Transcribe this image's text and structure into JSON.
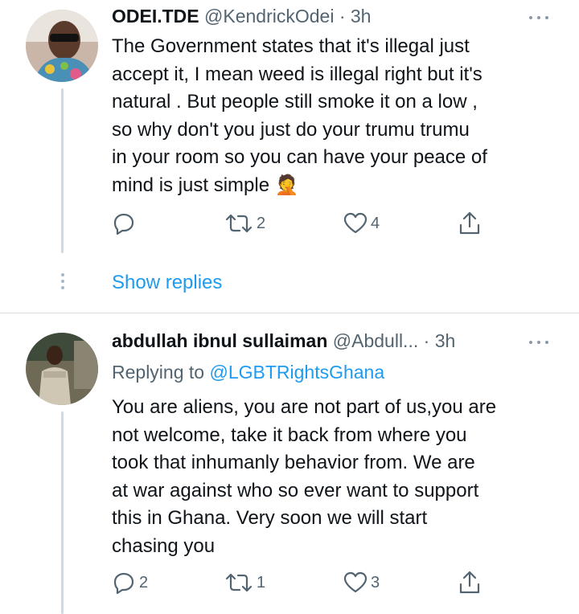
{
  "tweets": [
    {
      "name": "ODEI.TDE",
      "handle": "@KendrickOdei",
      "separator": "·",
      "time": "3h",
      "text_lines": [
        "The Government states that it's illegal just",
        "accept it, I mean weed is illegal right but it's",
        "natural . But people still smoke it on a low ,",
        "so why don't you just do your trumu trumu",
        "in your room so you can have your peace of",
        "mind is just simple"
      ],
      "emoji": "🤦",
      "actions": {
        "replies": "",
        "retweets": "2",
        "likes": "4"
      }
    },
    {
      "name": "abdullah ibnul sullaiman",
      "handle": "@Abdull...",
      "separator": "·",
      "time": "3h",
      "replying_prefix": "Replying to",
      "replying_mention": "@LGBTRightsGhana",
      "text_lines": [
        "You are aliens, you are not part of us,you are",
        "not welcome, take it back from where you",
        "took that inhumanly behavior from. We are",
        "at war against who so ever want to support",
        "this in Ghana. Very soon we will start",
        "chasing you"
      ],
      "actions": {
        "replies": "2",
        "retweets": "1",
        "likes": "3"
      }
    }
  ],
  "show_replies": "Show replies",
  "icons": {
    "reply": "reply-icon",
    "retweet": "retweet-icon",
    "like": "heart-icon",
    "share": "share-icon",
    "more": "more-horizontal-icon"
  },
  "colors": {
    "link": "#1d9bf0",
    "muted": "#536471",
    "text": "#0f1419",
    "thread_line": "#cfd9de"
  }
}
